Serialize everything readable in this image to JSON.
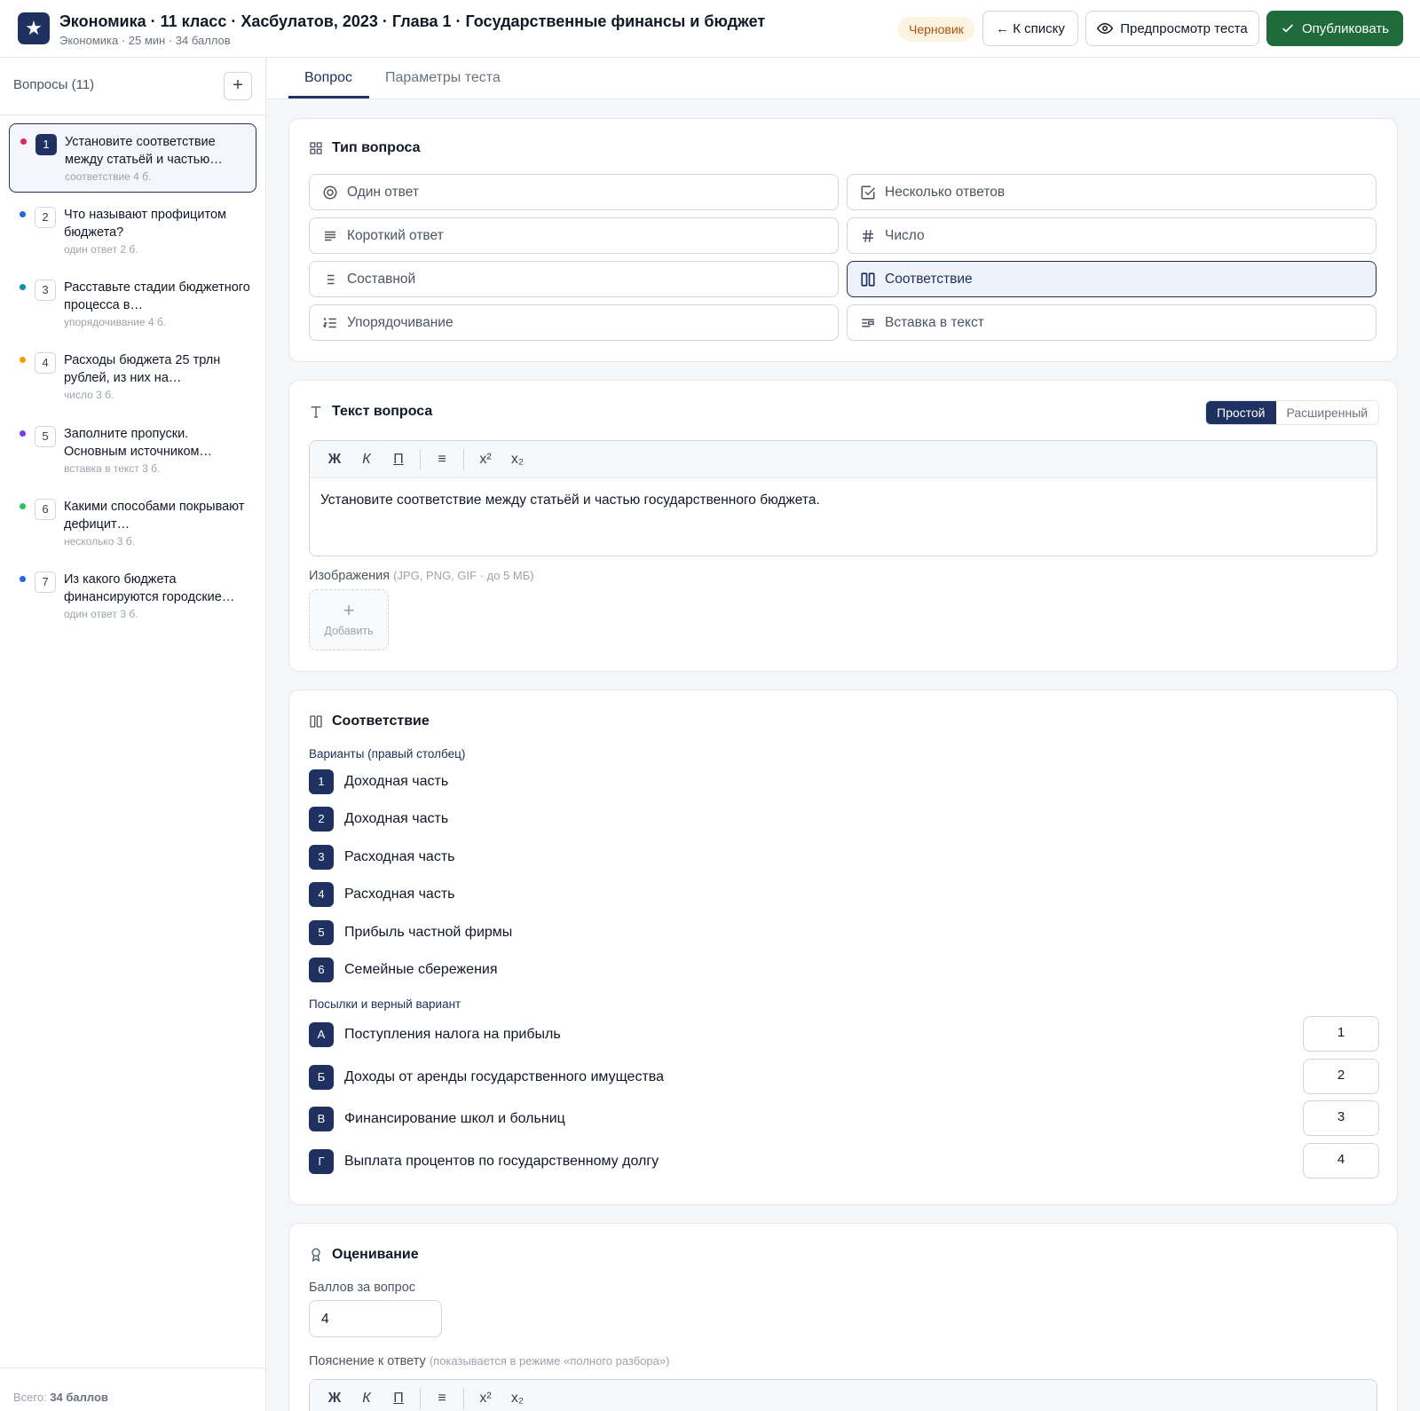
{
  "header": {
    "title": "Экономика · 11 класс · Хасбулатов, 2023 · Глава 1 · Государственные финансы и бюджет",
    "subtitle": "Экономика · 25 мин · 34 баллов",
    "status_badge": "Черновик",
    "back_label": "← К списку",
    "preview_label": "Предпросмотр теста",
    "publish_label": "Опубликовать"
  },
  "sidebar": {
    "heading": "Вопросы (11)",
    "add_label": "+",
    "items": [
      {
        "num": "1",
        "text": "Установите соответствие между статьёй и частью…",
        "meta": "соответствие  4 б.",
        "dot": "#e0245e"
      },
      {
        "num": "2",
        "text": "Что называют профицитом бюджета?",
        "meta": "один ответ  2 б.",
        "dot": "#2563eb"
      },
      {
        "num": "3",
        "text": "Расставьте стадии бюджетного процесса в…",
        "meta": "упорядочивание  4 б.",
        "dot": "#0891b2"
      },
      {
        "num": "4",
        "text": "Расходы бюджета 25 трлн рублей, из них на…",
        "meta": "число  3 б.",
        "dot": "#f59e0b"
      },
      {
        "num": "5",
        "text": "Заполните пропуски. Основным источником…",
        "meta": "вставка в текст  3 б.",
        "dot": "#7c3aed"
      },
      {
        "num": "6",
        "text": "Какими способами покрывают дефицит…",
        "meta": "несколько  3 б.",
        "dot": "#22c55e"
      },
      {
        "num": "7",
        "text": "Из какого бюджета финансируются городские…",
        "meta": "один ответ  3 б.",
        "dot": "#2563eb"
      }
    ],
    "footer_prefix": "Всего: ",
    "footer_total": "34 баллов"
  },
  "tabs": [
    "Вопрос",
    "Параметры теста"
  ],
  "question_type": {
    "title": "Тип вопроса",
    "options": [
      {
        "label": "Один ответ",
        "icon": "radio-icon"
      },
      {
        "label": "Несколько ответов",
        "icon": "checkbox-icon"
      },
      {
        "label": "Короткий ответ",
        "icon": "short-text-icon"
      },
      {
        "label": "Число",
        "icon": "hash-icon"
      },
      {
        "label": "Составной",
        "icon": "list-icon"
      },
      {
        "label": "Соответствие",
        "icon": "columns-icon"
      },
      {
        "label": "Упорядочивание",
        "icon": "ordered-list-icon"
      },
      {
        "label": "Вставка в текст",
        "icon": "insert-text-icon"
      }
    ],
    "selected": "Соответствие"
  },
  "question_text": {
    "title": "Текст вопроса",
    "mode_simple": "Простой",
    "mode_advanced": "Расширенный",
    "toolbar": [
      "Ж",
      "К",
      "П",
      "≡",
      "x²",
      "x₂"
    ],
    "body": "Установите соответствие между статьёй и частью государственного бюджета.",
    "images_label": "Изображения",
    "images_hint": "(JPG, PNG, GIF · до 5 МБ)",
    "add_image_label": "Добавить"
  },
  "matching": {
    "title": "Соответствие",
    "options_label": "Варианты (правый столбец)",
    "options": [
      {
        "n": "1",
        "text": "Доходная часть"
      },
      {
        "n": "2",
        "text": "Доходная часть"
      },
      {
        "n": "3",
        "text": "Расходная часть"
      },
      {
        "n": "4",
        "text": "Расходная часть"
      },
      {
        "n": "5",
        "text": "Прибыль частной фирмы"
      },
      {
        "n": "6",
        "text": "Семейные сбережения"
      }
    ],
    "premises_label": "Посылки и верный вариант",
    "premises": [
      {
        "letter": "А",
        "text": "Поступления налога на прибыль",
        "answer": "1"
      },
      {
        "letter": "Б",
        "text": "Доходы от аренды государственного имущества",
        "answer": "2"
      },
      {
        "letter": "В",
        "text": "Финансирование школ и больниц",
        "answer": "3"
      },
      {
        "letter": "Г",
        "text": "Выплата процентов по государственному долгу",
        "answer": "4"
      }
    ]
  },
  "grading": {
    "title": "Оценивание",
    "points_label": "Баллов за вопрос",
    "points_value": "4",
    "explanation_label": "Пояснение к ответу",
    "explanation_hint": "(показывается в режиме «полного разбора»)"
  },
  "colors": {
    "accent": "#1f3160",
    "publish": "#1f6b3a",
    "draft_bg": "#fdf3e1",
    "draft_text": "#b45309"
  }
}
